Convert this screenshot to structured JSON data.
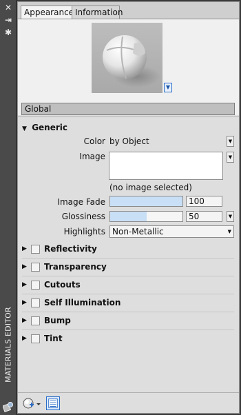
{
  "window": {
    "vertical_title": "MATERIALS EDITOR"
  },
  "tabs": [
    {
      "label": "Appearance",
      "active": true
    },
    {
      "label": "Information",
      "active": false
    }
  ],
  "preview": {
    "dropdown_icon": "chevron-down-icon"
  },
  "material_name": "Global",
  "generic": {
    "header": "Generic",
    "color": {
      "label": "Color",
      "value": "by Object"
    },
    "image": {
      "label": "Image",
      "status": "(no image selected)"
    },
    "image_fade": {
      "label": "Image Fade",
      "value": "100",
      "level": 1.0
    },
    "glossiness": {
      "label": "Glossiness",
      "value": "50",
      "level": 0.5
    },
    "highlights": {
      "label": "Highlights",
      "value": "Non-Metallic"
    }
  },
  "sections": [
    {
      "label": "Reflectivity"
    },
    {
      "label": "Transparency"
    },
    {
      "label": "Cutouts"
    },
    {
      "label": "Self Illumination"
    },
    {
      "label": "Bump"
    },
    {
      "label": "Tint"
    }
  ],
  "colors": {
    "accent": "#2c6dc7",
    "slider_fill": "#c9dff5",
    "panel_bg": "#dedede",
    "strip_bg": "#4a4a4a"
  }
}
